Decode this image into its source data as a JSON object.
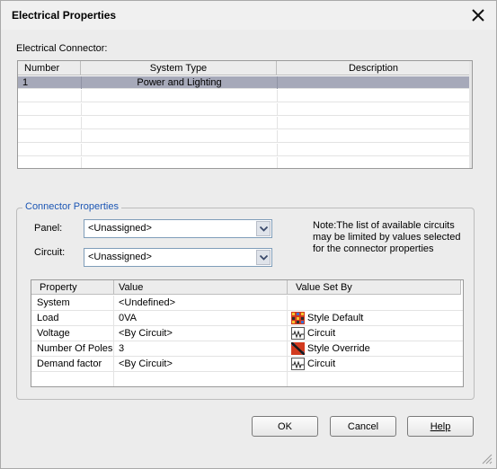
{
  "dialog": {
    "title": "Electrical Properties",
    "close_glyph": "✕"
  },
  "connector": {
    "section_label": "Electrical Connector:",
    "columns": [
      "Number",
      "System Type",
      "Description"
    ],
    "rows": [
      {
        "number": "1",
        "system_type": "Power and Lighting",
        "description": ""
      }
    ],
    "selected_row": 0
  },
  "connector_properties": {
    "group_title": "Connector Properties",
    "panel_label": "Panel:",
    "panel_value": "<Unassigned>",
    "circuit_label": "Circuit:",
    "circuit_value": "<Unassigned>",
    "note": "Note:The list of available circuits may be limited by values selected for the connector properties",
    "columns": [
      "Property",
      "Value",
      "Value Set By"
    ],
    "rows": [
      {
        "property": "System",
        "value": "<Undefined>",
        "set_by": "",
        "icon": ""
      },
      {
        "property": "Load",
        "value": "0VA",
        "set_by": "Style Default",
        "icon": "style-default-icon"
      },
      {
        "property": "Voltage",
        "value": "<By Circuit>",
        "set_by": "Circuit",
        "icon": "circuit-icon"
      },
      {
        "property": "Number Of Poles",
        "value": "3",
        "set_by": "Style Override",
        "icon": "style-override-icon"
      },
      {
        "property": "Demand factor",
        "value": "<By Circuit>",
        "set_by": "Circuit",
        "icon": "circuit-icon"
      }
    ]
  },
  "buttons": {
    "ok": "OK",
    "cancel": "Cancel",
    "help": "Help"
  }
}
